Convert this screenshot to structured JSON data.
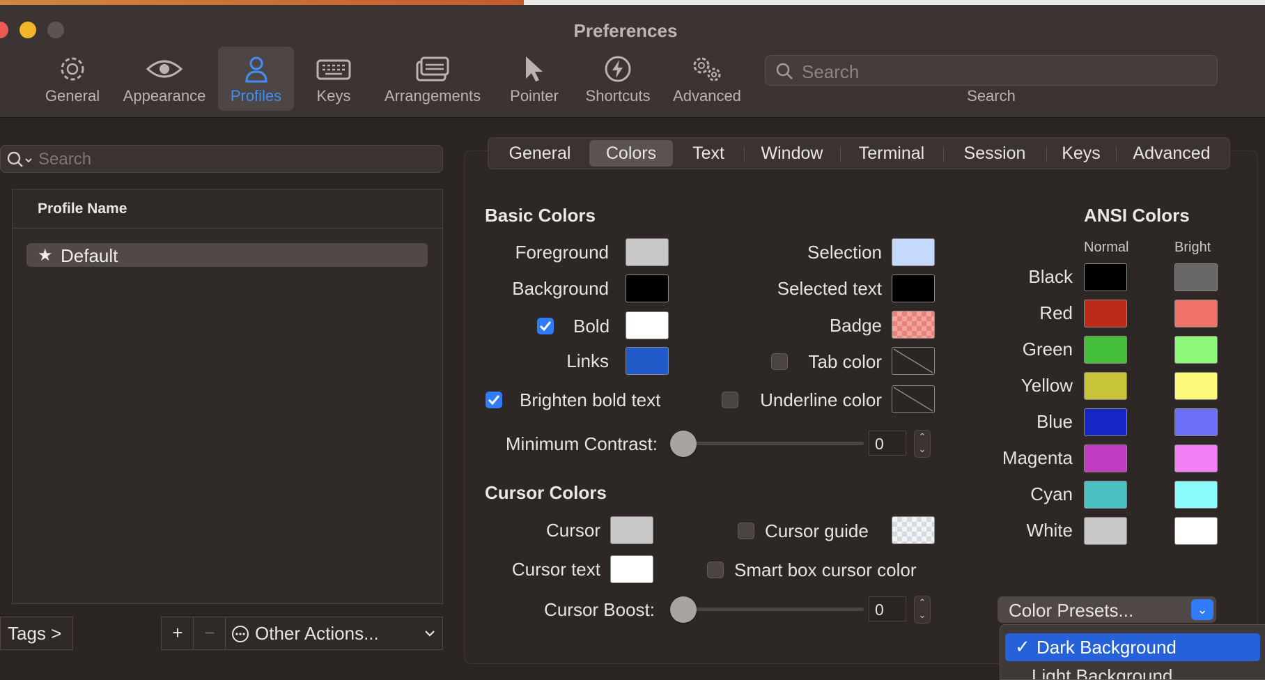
{
  "window": {
    "title": "Preferences"
  },
  "toolbar": {
    "items": [
      {
        "label": "General",
        "icon": "gear-icon"
      },
      {
        "label": "Appearance",
        "icon": "eye-icon"
      },
      {
        "label": "Profiles",
        "icon": "person-icon",
        "selected": true
      },
      {
        "label": "Keys",
        "icon": "keyboard-icon"
      },
      {
        "label": "Arrangements",
        "icon": "windows-icon"
      },
      {
        "label": "Pointer",
        "icon": "pointer-icon"
      },
      {
        "label": "Shortcuts",
        "icon": "lightning-icon"
      },
      {
        "label": "Advanced",
        "icon": "gears-icon"
      }
    ],
    "search_placeholder": "Search",
    "search_caption": "Search"
  },
  "profiles": {
    "search_placeholder": "Search",
    "column_header": "Profile Name",
    "rows": [
      {
        "name": "Default",
        "starred": true
      }
    ],
    "tags_button": "Tags >",
    "add_symbol": "+",
    "remove_symbol": "−",
    "other_actions": "Other Actions..."
  },
  "tabs": [
    "General",
    "Colors",
    "Text",
    "Window",
    "Terminal",
    "Session",
    "Keys",
    "Advanced"
  ],
  "selected_tab": "Colors",
  "basic_colors": {
    "title": "Basic Colors",
    "foreground": {
      "label": "Foreground",
      "color": "#c8c8c8"
    },
    "background": {
      "label": "Background",
      "color": "#000000"
    },
    "bold": {
      "label": "Bold",
      "color": "#ffffff",
      "checked": true
    },
    "links": {
      "label": "Links",
      "color": "#2059c8"
    },
    "brighten_bold": {
      "label": "Brighten bold text",
      "checked": true
    },
    "selection": {
      "label": "Selection",
      "color": "#c4d9fb"
    },
    "selected_text": {
      "label": "Selected text",
      "color": "#000000"
    },
    "badge": {
      "label": "Badge",
      "color": "#e8837a"
    },
    "tab_color": {
      "label": "Tab color",
      "checked": false
    },
    "underline_color": {
      "label": "Underline color",
      "checked": false
    },
    "minimum_contrast": {
      "label": "Minimum Contrast:",
      "value": "0"
    }
  },
  "cursor_colors": {
    "title": "Cursor Colors",
    "cursor": {
      "label": "Cursor",
      "color": "#c8c8c8"
    },
    "cursor_text": {
      "label": "Cursor text",
      "color": "#ffffff"
    },
    "cursor_guide": {
      "label": "Cursor guide",
      "checked": false
    },
    "smart_box": {
      "label": "Smart box cursor color",
      "checked": false
    },
    "cursor_boost": {
      "label": "Cursor Boost:",
      "value": "0"
    }
  },
  "ansi": {
    "title": "ANSI Colors",
    "normal_header": "Normal",
    "bright_header": "Bright",
    "rows": [
      {
        "name": "Black",
        "normal": "#000000",
        "bright": "#686868"
      },
      {
        "name": "Red",
        "normal": "#bb2a1a",
        "bright": "#ef7366"
      },
      {
        "name": "Green",
        "normal": "#44c03a",
        "bright": "#8df87a"
      },
      {
        "name": "Yellow",
        "normal": "#c7c43a",
        "bright": "#fdf97a"
      },
      {
        "name": "Blue",
        "normal": "#1526c5",
        "bright": "#6b70f7"
      },
      {
        "name": "Magenta",
        "normal": "#c03dc3",
        "bright": "#f27ff6"
      },
      {
        "name": "Cyan",
        "normal": "#4ac2c4",
        "bright": "#8bfafd"
      },
      {
        "name": "White",
        "normal": "#c8c8c8",
        "bright": "#ffffff"
      }
    ]
  },
  "presets": {
    "button_label": "Color Presets...",
    "menu": [
      {
        "label": "Dark Background",
        "checked": true
      },
      {
        "label": "Light Background",
        "checked": false
      }
    ]
  },
  "colors": {
    "accent": "#2f7cf6",
    "menu_highlight": "#2561d8"
  }
}
